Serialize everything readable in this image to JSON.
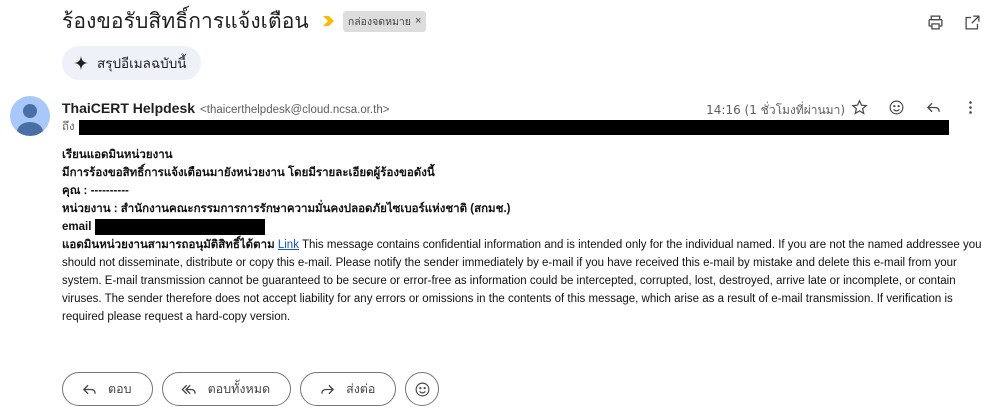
{
  "header": {
    "subject": "ร้องขอรับสิทธิ์การแจ้งเตือน",
    "label_chip": "กล่องจดหมาย",
    "label_chip_remove": "×"
  },
  "summary_button": {
    "label": "สรุปอีเมลฉบับนี้",
    "icon": "sparkle-icon"
  },
  "message": {
    "sender_name": "ThaiCERT Helpdesk",
    "sender_email": "<thaicerthelpdesk@cloud.ncsa.or.th>",
    "time": "14:16 (1 ชั่วโมงที่ผ่านมา)",
    "to_label": "ถึง",
    "body": {
      "greeting": "เรียนแอดมินหน่วยงาน",
      "intro": "มีการร้องขอสิทธิ์การแจ้งเตือนมายังหน่วยงาน โดยมีรายละเอียดผู้ร้องขอดังนี้",
      "name_line": "คุณ : ----------",
      "org_line": "หน่วยงาน : สำนักงานคณะกรรมการการรักษาความมั่นคงปลอดภัยไซเบอร์แห่งชาติ (สกมช.)",
      "email_label": "email",
      "approve_text": "แอดมินหน่วยงานสามารถอนุมัติสิทธิ์ได้ตาม",
      "link_text": "Link",
      "disclaimer": " This message contains confidential information and is intended only for the individual named. If you are not the named addressee you should not disseminate, distribute or copy this e-mail. Please notify the sender immediately by e-mail if you have received this e-mail by mistake and delete this e-mail from your system. E-mail transmission cannot be guaranteed to be secure or error-free as information could be intercepted, corrupted, lost, destroyed, arrive late or incomplete, or contain viruses. The sender therefore does not accept liability for any errors or omissions in the contents of this message, which arise as a result of e-mail transmission. If verification is required please request a hard-copy version."
    }
  },
  "actions": {
    "reply": "ตอบ",
    "reply_all": "ตอบทั้งหมด",
    "forward": "ส่งต่อ"
  },
  "colors": {
    "important": "#f9bc05",
    "link": "#1155cc",
    "avatar": "#a8c7fa"
  }
}
